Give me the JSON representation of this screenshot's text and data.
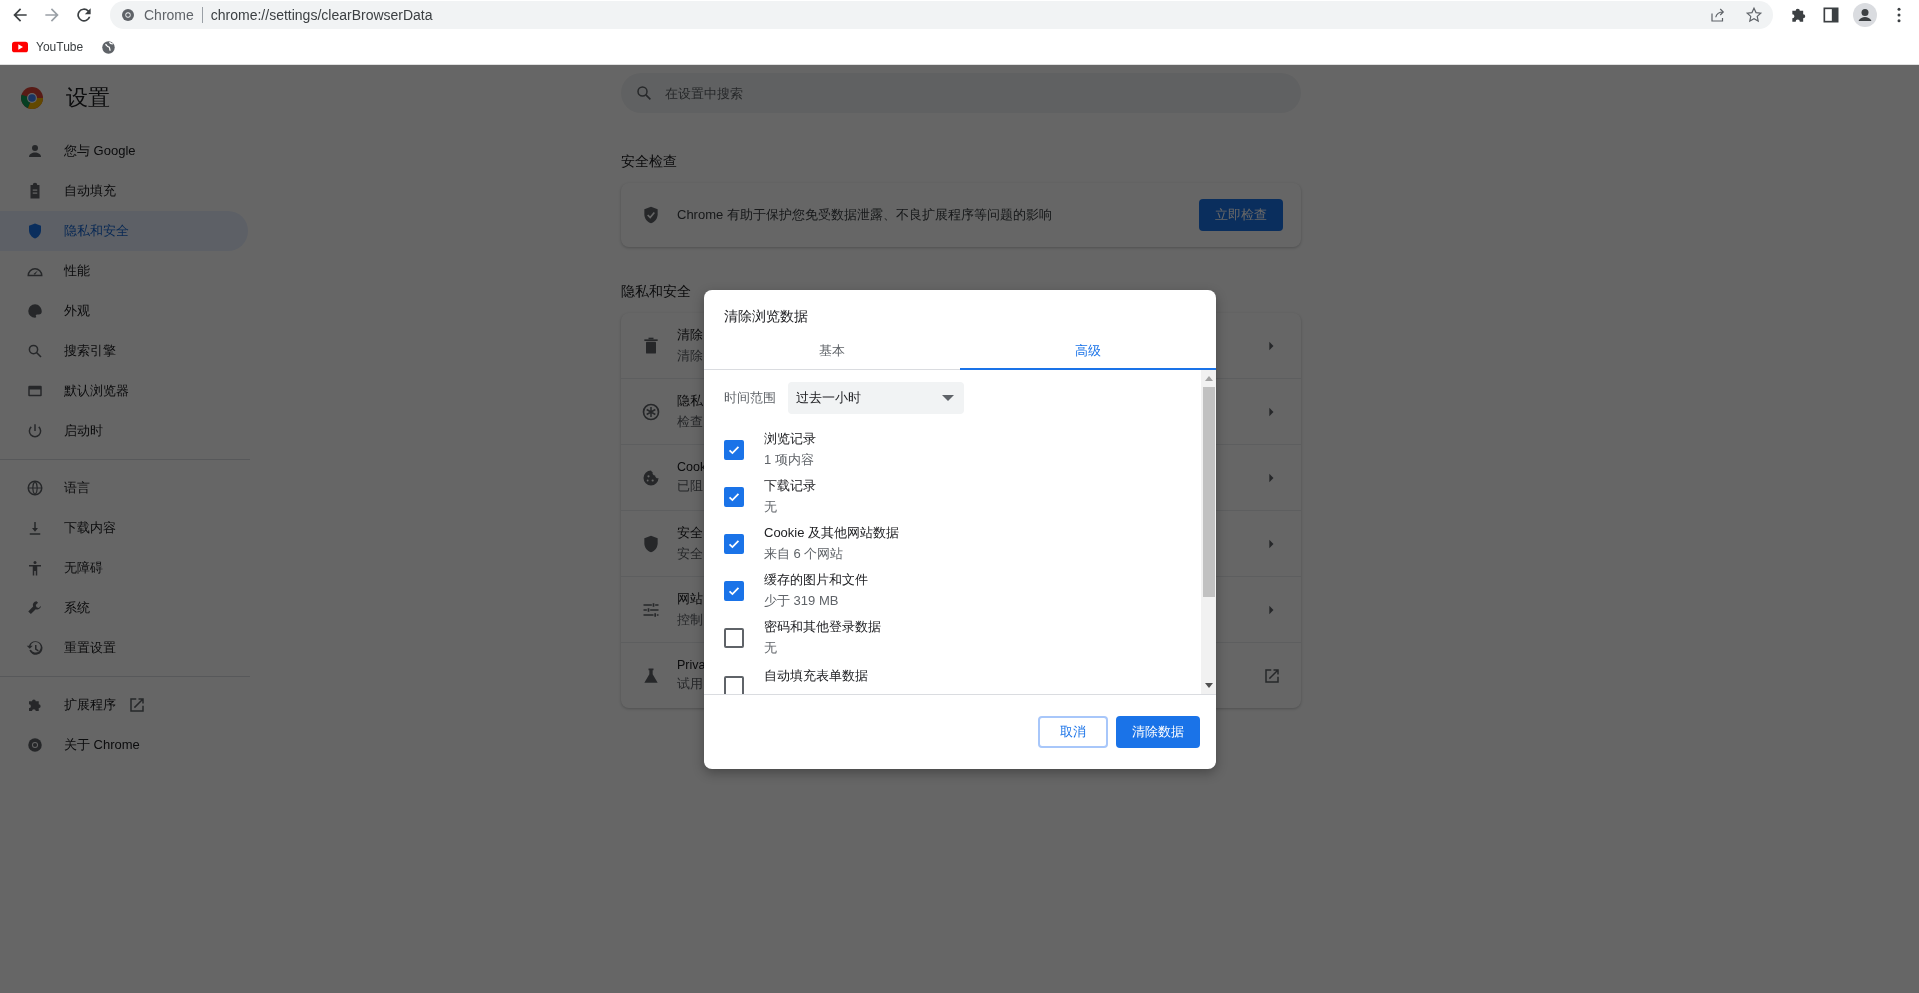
{
  "omnibox": {
    "site_label": "Chrome",
    "url": "chrome://settings/clearBrowserData"
  },
  "bookmarks": [
    {
      "kind": "youtube",
      "label": "YouTube"
    },
    {
      "kind": "globe"
    }
  ],
  "settings": {
    "title": "设置",
    "sidebar": [
      [
        {
          "label": "您与 Google",
          "selected": false
        },
        {
          "label": "自动填充",
          "selected": false
        },
        {
          "label": "隐私和安全",
          "selected": true
        },
        {
          "label": "性能",
          "selected": false
        },
        {
          "label": "外观",
          "selected": false
        },
        {
          "label": "搜索引擎",
          "selected": false
        },
        {
          "label": "默认浏览器",
          "selected": false
        },
        {
          "label": "启动时",
          "selected": false
        }
      ],
      [
        {
          "label": "语言",
          "selected": false
        },
        {
          "label": "下载内容",
          "selected": false
        },
        {
          "label": "无障碍",
          "selected": false
        },
        {
          "label": "系统",
          "selected": false
        },
        {
          "label": "重置设置",
          "selected": false
        }
      ],
      [
        {
          "label": "扩展程序",
          "selected": false,
          "external": true
        },
        {
          "label": "关于 Chrome",
          "selected": false,
          "external": false
        }
      ]
    ],
    "search": {
      "placeholder": "在设置中搜索"
    },
    "safety_check": {
      "heading": "安全检查",
      "text": "Chrome 有助于保护您免受数据泄露、不良扩展程序等问题的影响",
      "button": "立即检查"
    },
    "privacy": {
      "heading": "隐私和安全",
      "rows": [
        {
          "kind": "submenu",
          "title": "清除",
          "subtitle": "清除"
        },
        {
          "kind": "submenu",
          "title": "隐私",
          "subtitle": "检查"
        },
        {
          "kind": "submenu",
          "title": "Cook",
          "subtitle": "已阻"
        },
        {
          "kind": "submenu",
          "title": "安全",
          "subtitle": "安全"
        },
        {
          "kind": "submenu",
          "title": "网站",
          "subtitle": "控制"
        },
        {
          "kind": "link",
          "title": "Priva",
          "subtitle": "试用"
        }
      ]
    }
  },
  "dialog": {
    "title": "清除浏览数据",
    "tabs": [
      {
        "label": "基本",
        "selected": false
      },
      {
        "label": "高级",
        "selected": true
      }
    ],
    "time_range": {
      "label": "时间范围",
      "value": "过去一小时"
    },
    "items": [
      {
        "label": "浏览记录",
        "detail": "1 项内容",
        "checked": true
      },
      {
        "label": "下载记录",
        "detail": "无",
        "checked": true
      },
      {
        "label": "Cookie 及其他网站数据",
        "detail": "来自 6 个网站",
        "checked": true
      },
      {
        "label": "缓存的图片和文件",
        "detail": "少于 319 MB",
        "checked": true
      },
      {
        "label": "密码和其他登录数据",
        "detail": "无",
        "checked": false
      },
      {
        "label": "自动填充表单数据",
        "checked": false
      }
    ],
    "cancel": "取消",
    "confirm": "清除数据"
  }
}
